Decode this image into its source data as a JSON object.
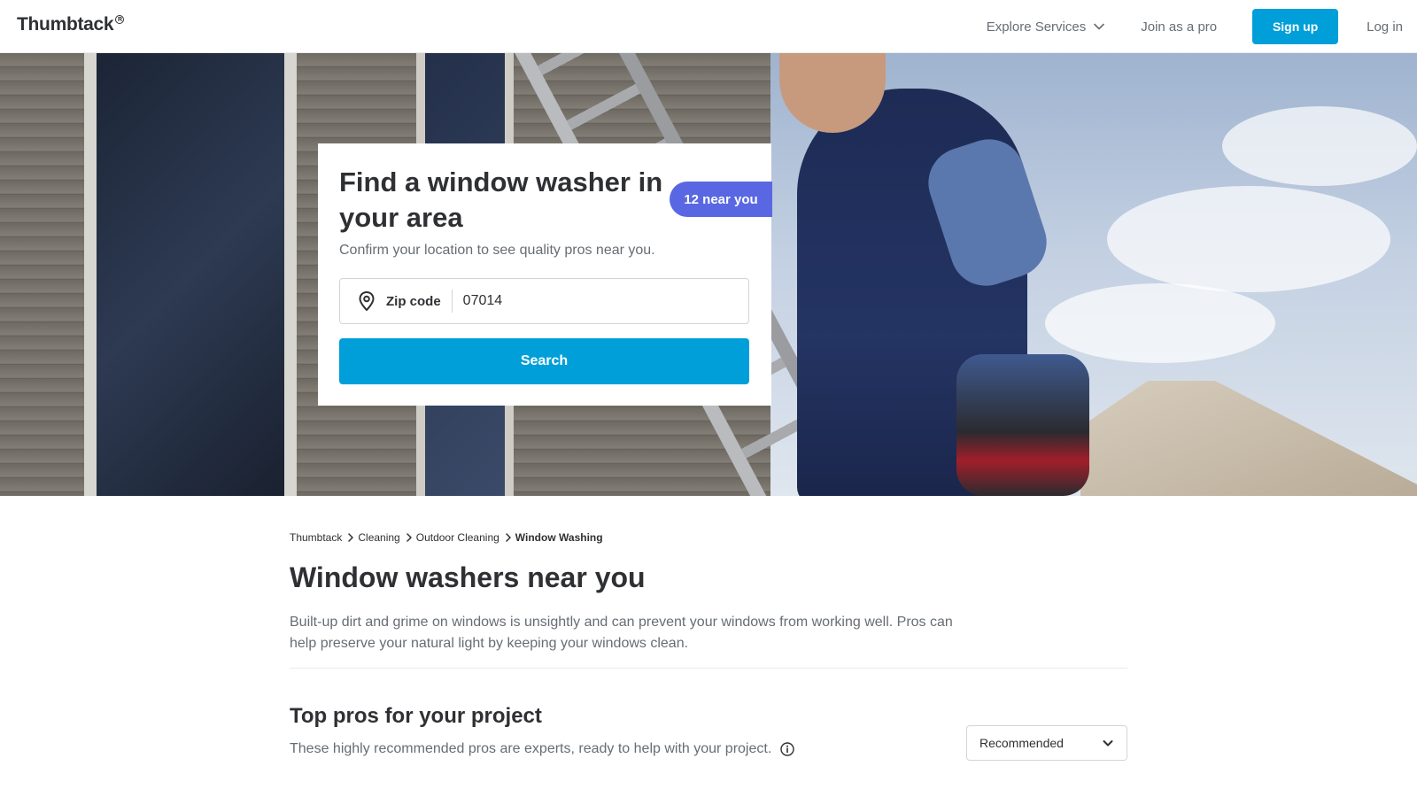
{
  "header": {
    "logo": "Thumbtack",
    "logo_mark": "R",
    "explore_label": "Explore Services",
    "join_label": "Join as a pro",
    "signup_label": "Sign up",
    "login_label": "Log in"
  },
  "hero": {
    "title": "Find a window washer in your area",
    "near_badge": "12 near you",
    "subtitle": "Confirm your location to see quality pros near you.",
    "zip_label": "Zip code",
    "zip_value": "07014",
    "search_label": "Search"
  },
  "breadcrumb": {
    "items": [
      "Thumbtack",
      "Cleaning",
      "Outdoor Cleaning",
      "Window Washing"
    ]
  },
  "main": {
    "title": "Window washers near you",
    "description": "Built-up dirt and grime on windows is unsightly and can prevent your windows from working well. Pros can help preserve your natural light by keeping your windows clean.",
    "section_title": "Top pros for your project",
    "section_subtitle": "These highly recommended pros are experts, ready to help with your project.",
    "sort_value": "Recommended"
  },
  "colors": {
    "brand_blue": "#009fd9",
    "badge_purple": "#5968e2",
    "text_dark": "#2f3033",
    "text_muted": "#676d73"
  },
  "icons": [
    "chevron-down-icon",
    "location-pin-icon",
    "chevron-right-icon",
    "info-icon"
  ]
}
